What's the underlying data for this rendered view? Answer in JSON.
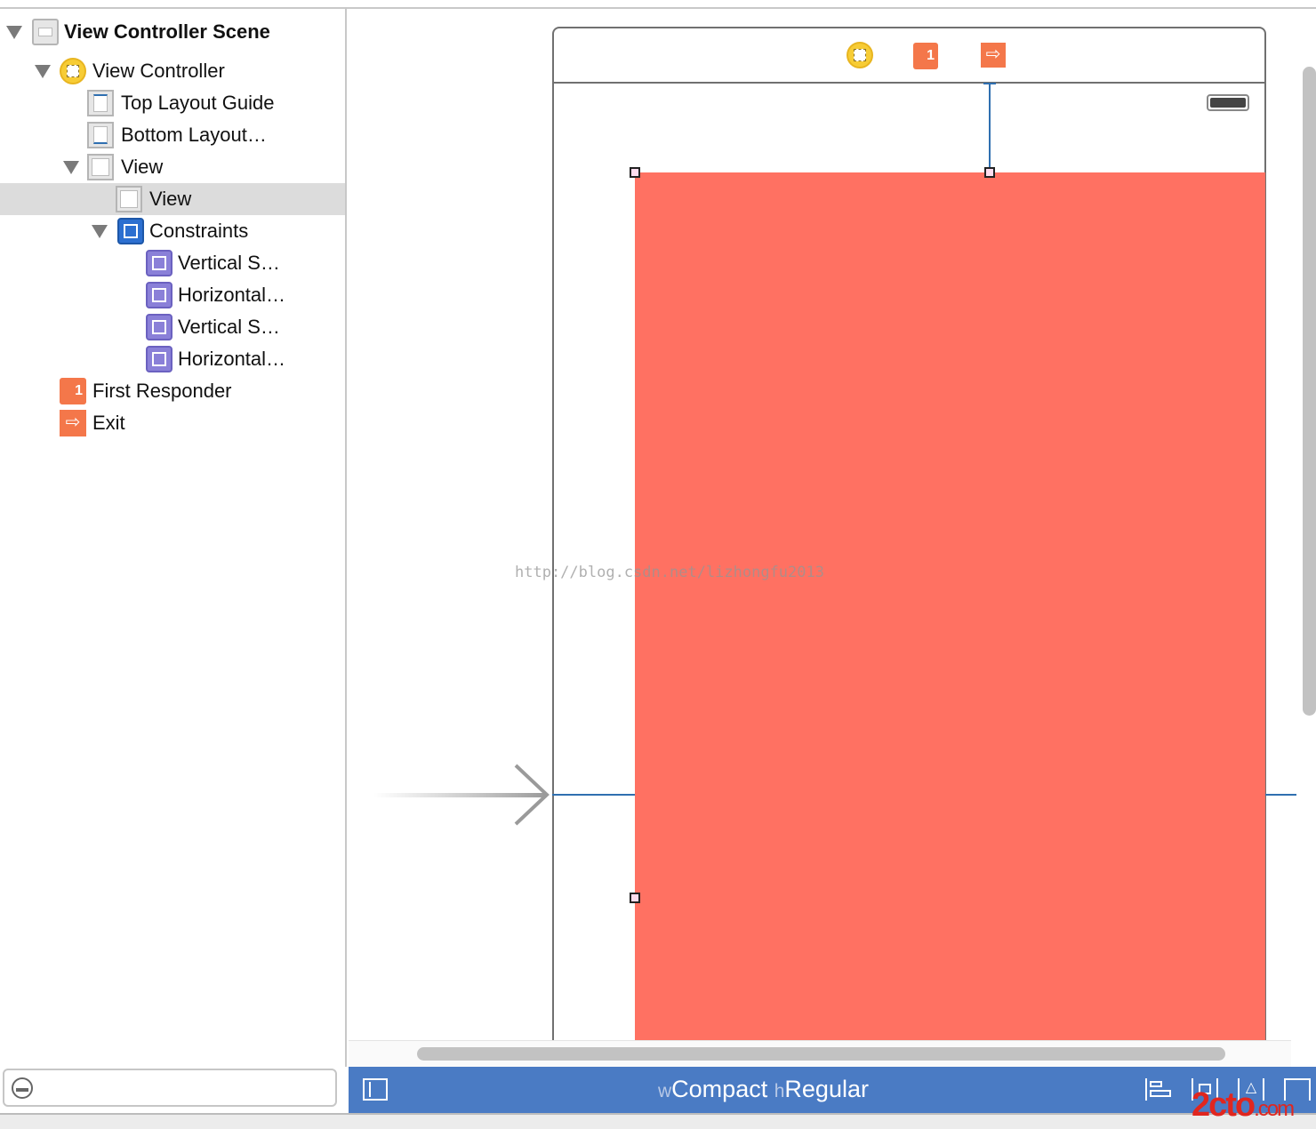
{
  "outline": {
    "items": [
      {
        "label": "View Controller Scene",
        "icon": "scene-icon",
        "expanded": true,
        "bold": true
      },
      {
        "label": "View Controller",
        "icon": "view-controller-icon",
        "expanded": true
      },
      {
        "label": "Top Layout Guide",
        "icon": "top-layout-guide-icon"
      },
      {
        "label": "Bottom Layout…",
        "icon": "bottom-layout-guide-icon"
      },
      {
        "label": "View",
        "icon": "view-icon",
        "expanded": true
      },
      {
        "label": "View",
        "icon": "view-icon",
        "selected": true
      },
      {
        "label": "Constraints",
        "icon": "constraints-icon",
        "expanded": true
      },
      {
        "label": "Vertical S…",
        "icon": "vertical-space-constraint-icon"
      },
      {
        "label": "Horizontal…",
        "icon": "horizontal-space-constraint-icon"
      },
      {
        "label": "Vertical S…",
        "icon": "vertical-space-constraint-icon"
      },
      {
        "label": "Horizontal…",
        "icon": "horizontal-space-constraint-icon"
      },
      {
        "label": "First Responder",
        "icon": "first-responder-icon"
      },
      {
        "label": "Exit",
        "icon": "exit-icon"
      }
    ],
    "filter_placeholder": ""
  },
  "canvas": {
    "view_color": "#ff7162",
    "watermark": "http://blog.csdn.net/lizhongfu2013"
  },
  "size_class": {
    "w_prefix": "w",
    "width": "Compact",
    "h_prefix": "h",
    "height": "Regular"
  },
  "colors": {
    "bar": "#4a7bc4",
    "constraint": "#2f6fb0",
    "selection": "#dcdcdc"
  },
  "logo_watermark": "2cto.com"
}
